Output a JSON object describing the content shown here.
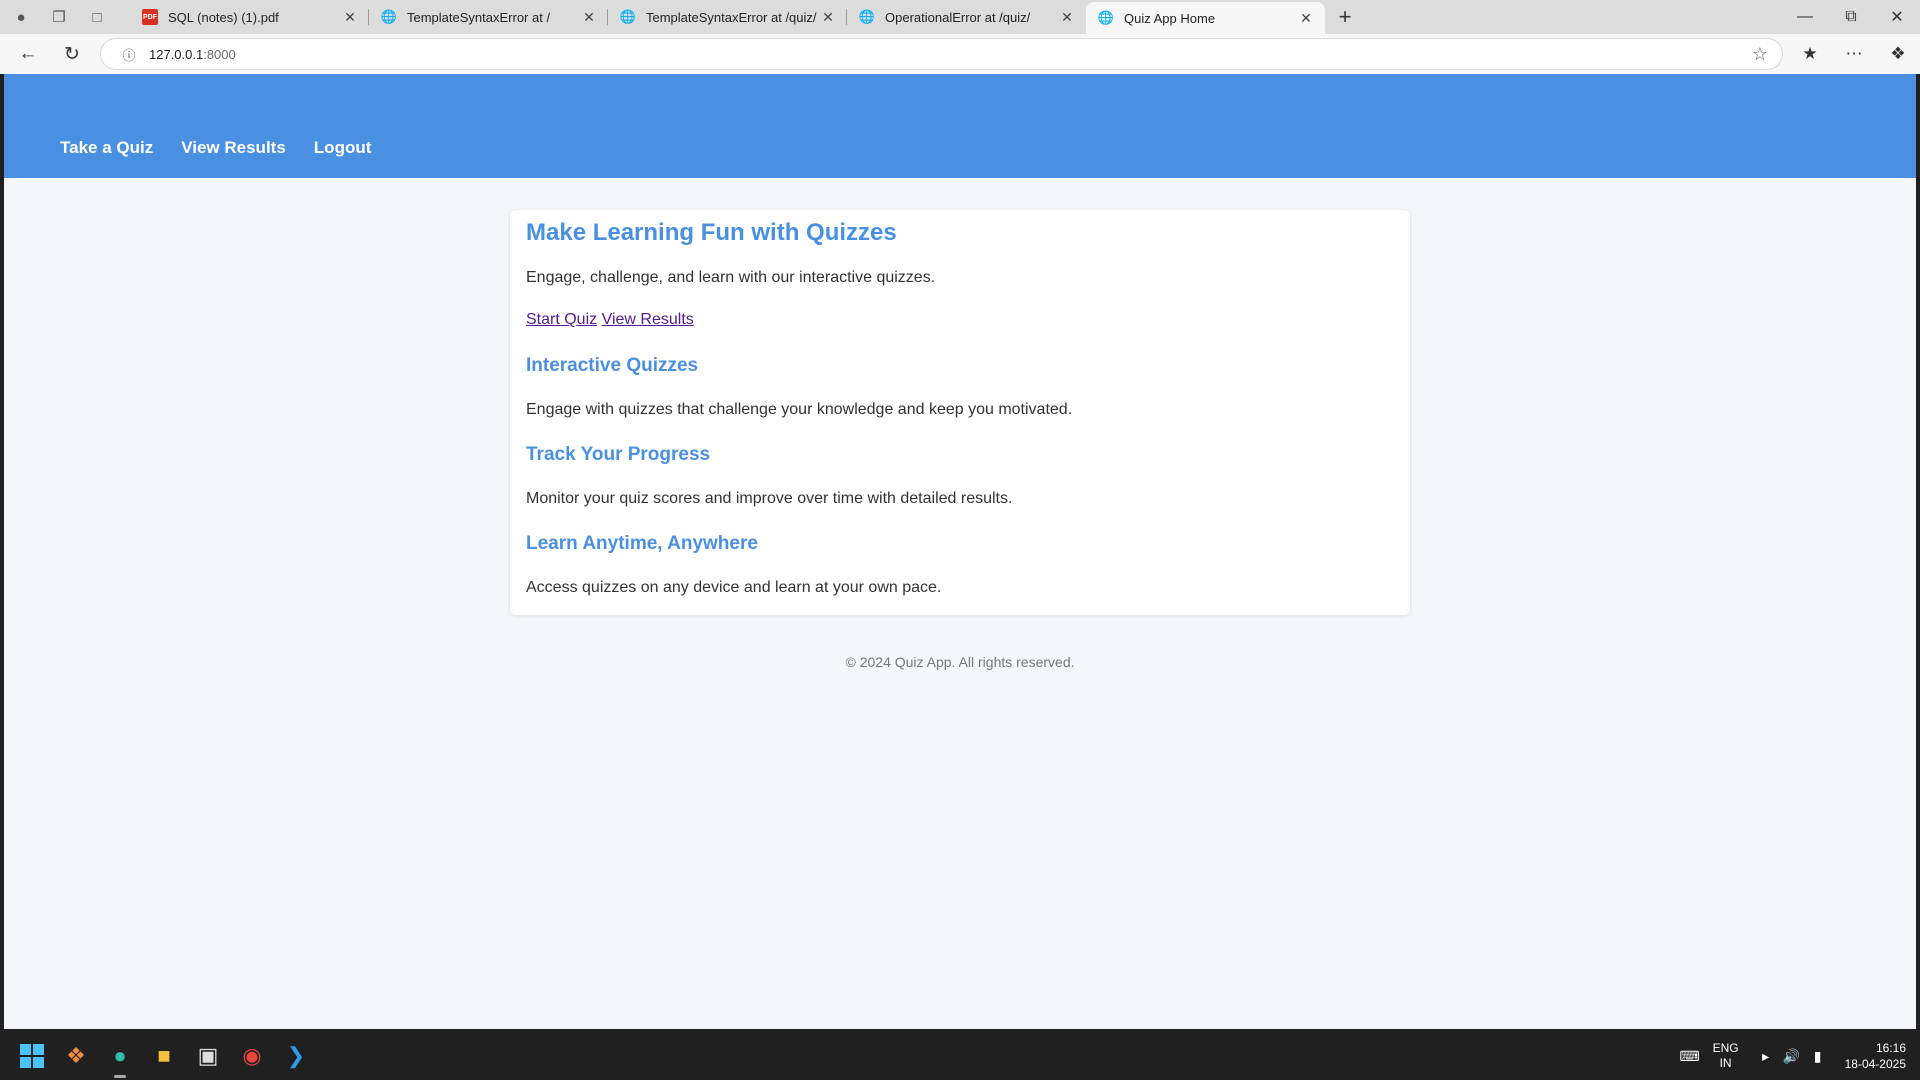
{
  "browser": {
    "tabs": [
      {
        "title": "SQL (notes) (1).pdf",
        "icon": "pdf-icon"
      },
      {
        "title": "TemplateSyntaxError at /",
        "icon": "globe-icon"
      },
      {
        "title": "TemplateSyntaxError at /quiz/",
        "icon": "globe-icon"
      },
      {
        "title": "OperationalError at /quiz/",
        "icon": "globe-icon"
      },
      {
        "title": "Quiz App Home",
        "icon": "globe-icon",
        "active": true
      }
    ],
    "url_host": "127.0.0.1",
    "url_port": ":8000"
  },
  "nav": {
    "take_quiz": "Take a Quiz",
    "view_results": "View Results",
    "logout": "Logout"
  },
  "hero": {
    "title": "Make Learning Fun with Quizzes",
    "intro": "Engage, challenge, and learn with our interactive quizzes.",
    "start_quiz": "Start Quiz",
    "view_results": "View Results"
  },
  "features": [
    {
      "title": "Interactive Quizzes",
      "desc": "Engage with quizzes that challenge your knowledge and keep you motivated."
    },
    {
      "title": "Track Your Progress",
      "desc": "Monitor your quiz scores and improve over time with detailed results."
    },
    {
      "title": "Learn Anytime, Anywhere",
      "desc": "Access quizzes on any device and learn at your own pace."
    }
  ],
  "footer": {
    "text": "© 2024 Quiz App. All rights reserved."
  },
  "taskbar": {
    "lang_top": "ENG",
    "lang_bottom": "IN",
    "time": "16:16",
    "date": "18-04-2025"
  },
  "colors": {
    "accent": "#4a90e2",
    "visited_link": "#551a8b",
    "page_bg": "#f5f6f9"
  }
}
